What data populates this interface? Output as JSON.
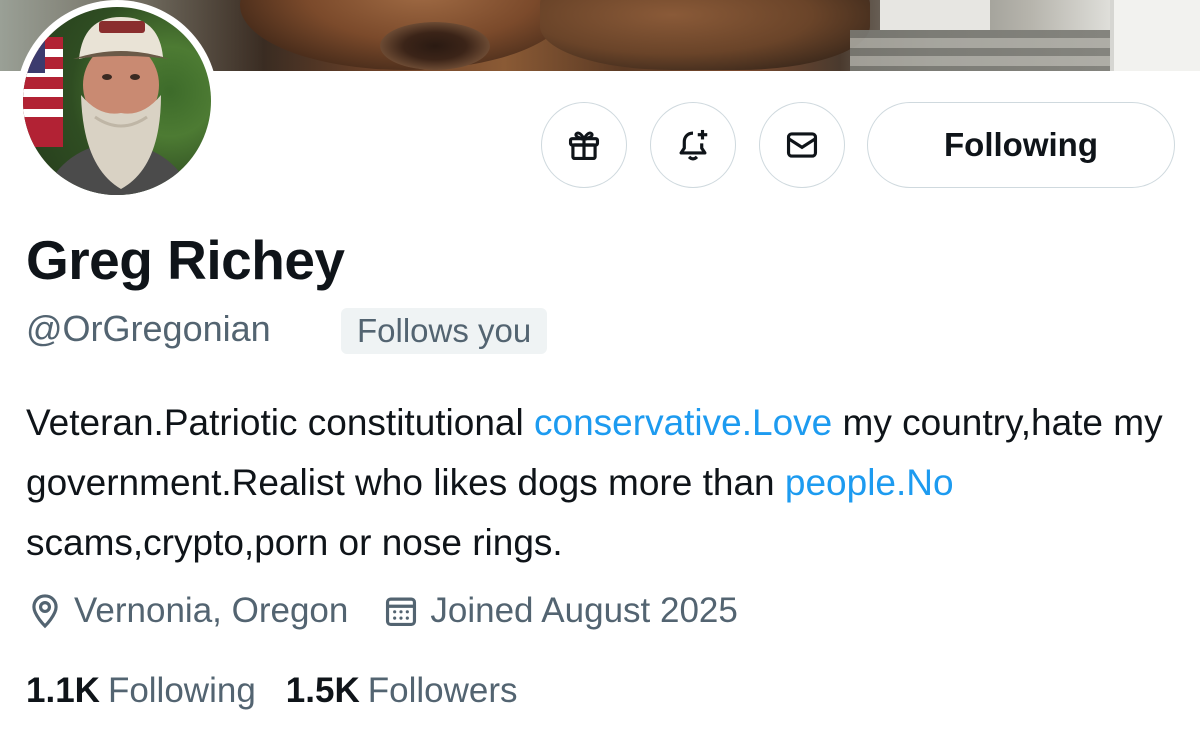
{
  "profile": {
    "display_name": "Greg Richey",
    "handle": "@OrGregonian",
    "follows_you_badge": "Follows you",
    "follow_button_label": "Following",
    "bio": {
      "part1": "Veteran.Patriotic constitutional ",
      "link1": "conservative.Love",
      "part2": " my country,hate my government.Realist who likes dogs more than ",
      "link2": "people.No",
      "part3": " scams,crypto,porn or nose rings."
    },
    "location": "Vernonia, Oregon",
    "joined": "Joined August 2025",
    "stats": {
      "following_count": "1.1K",
      "following_label": "Following",
      "followers_count": "1.5K",
      "followers_label": "Followers"
    }
  },
  "icons": {
    "gift": "gift-icon",
    "notify": "bell-plus-icon",
    "message": "envelope-icon",
    "location": "location-pin-icon",
    "calendar": "calendar-icon"
  },
  "colors": {
    "text_primary": "#0f1419",
    "text_secondary": "#536471",
    "link": "#1d9bf0",
    "border": "#cfd9de",
    "badge_bg": "#eff3f4"
  }
}
